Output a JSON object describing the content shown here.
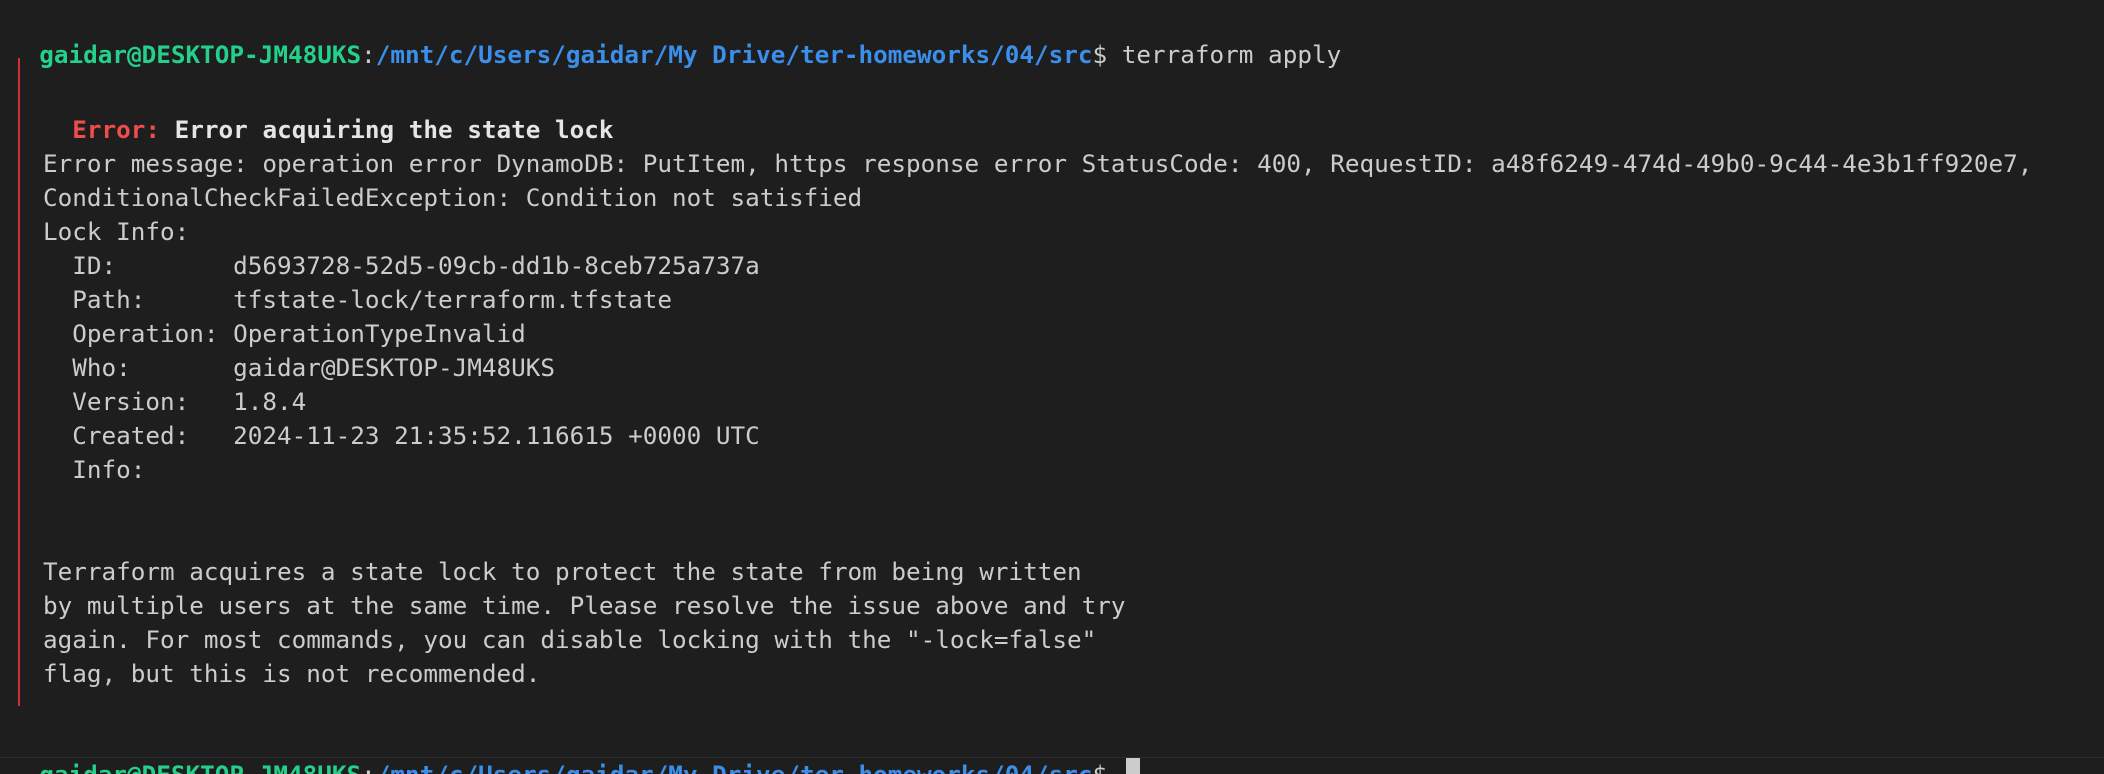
{
  "terminal": {
    "prompt": {
      "user_host": "gaidar@DESKTOP-JM48UKS",
      "separator": ":",
      "path": "/mnt/c/Users/gaidar/My Drive/ter-homeworks/04/src",
      "symbol": "$ "
    },
    "command": "terraform apply",
    "error": {
      "label": "Error: ",
      "title": "Error acquiring the state lock",
      "message_line1": "Error message: operation error DynamoDB: PutItem, https response error StatusCode: 400, RequestID: a48f6249-474d-49b0-9c44-4e3b1ff920e7,",
      "message_line2": "ConditionalCheckFailedException: Condition not satisfied",
      "lock_info_header": "Lock Info:",
      "lock_info": [
        {
          "key": "  ID:        ",
          "value": "d5693728-52d5-09cb-dd1b-8ceb725a737a"
        },
        {
          "key": "  Path:      ",
          "value": "tfstate-lock/terraform.tfstate"
        },
        {
          "key": "  Operation: ",
          "value": "OperationTypeInvalid"
        },
        {
          "key": "  Who:       ",
          "value": "gaidar@DESKTOP-JM48UKS"
        },
        {
          "key": "  Version:   ",
          "value": "1.8.4"
        },
        {
          "key": "  Created:   ",
          "value": "2024-11-23 21:35:52.116615 +0000 UTC"
        },
        {
          "key": "  Info:      ",
          "value": ""
        }
      ],
      "explanation": [
        "Terraform acquires a state lock to protect the state from being written",
        "by multiple users at the same time. Please resolve the issue above and try",
        "again. For most commands, you can disable locking with the \"-lock=false\"",
        "flag, but this is not recommended."
      ]
    },
    "colors": {
      "background": "#1e1e1e",
      "prompt_user": "#23d18b",
      "prompt_path": "#3b8eea",
      "error_red": "#f14c4c",
      "error_border": "#cd3131",
      "text": "#cccccc"
    }
  }
}
